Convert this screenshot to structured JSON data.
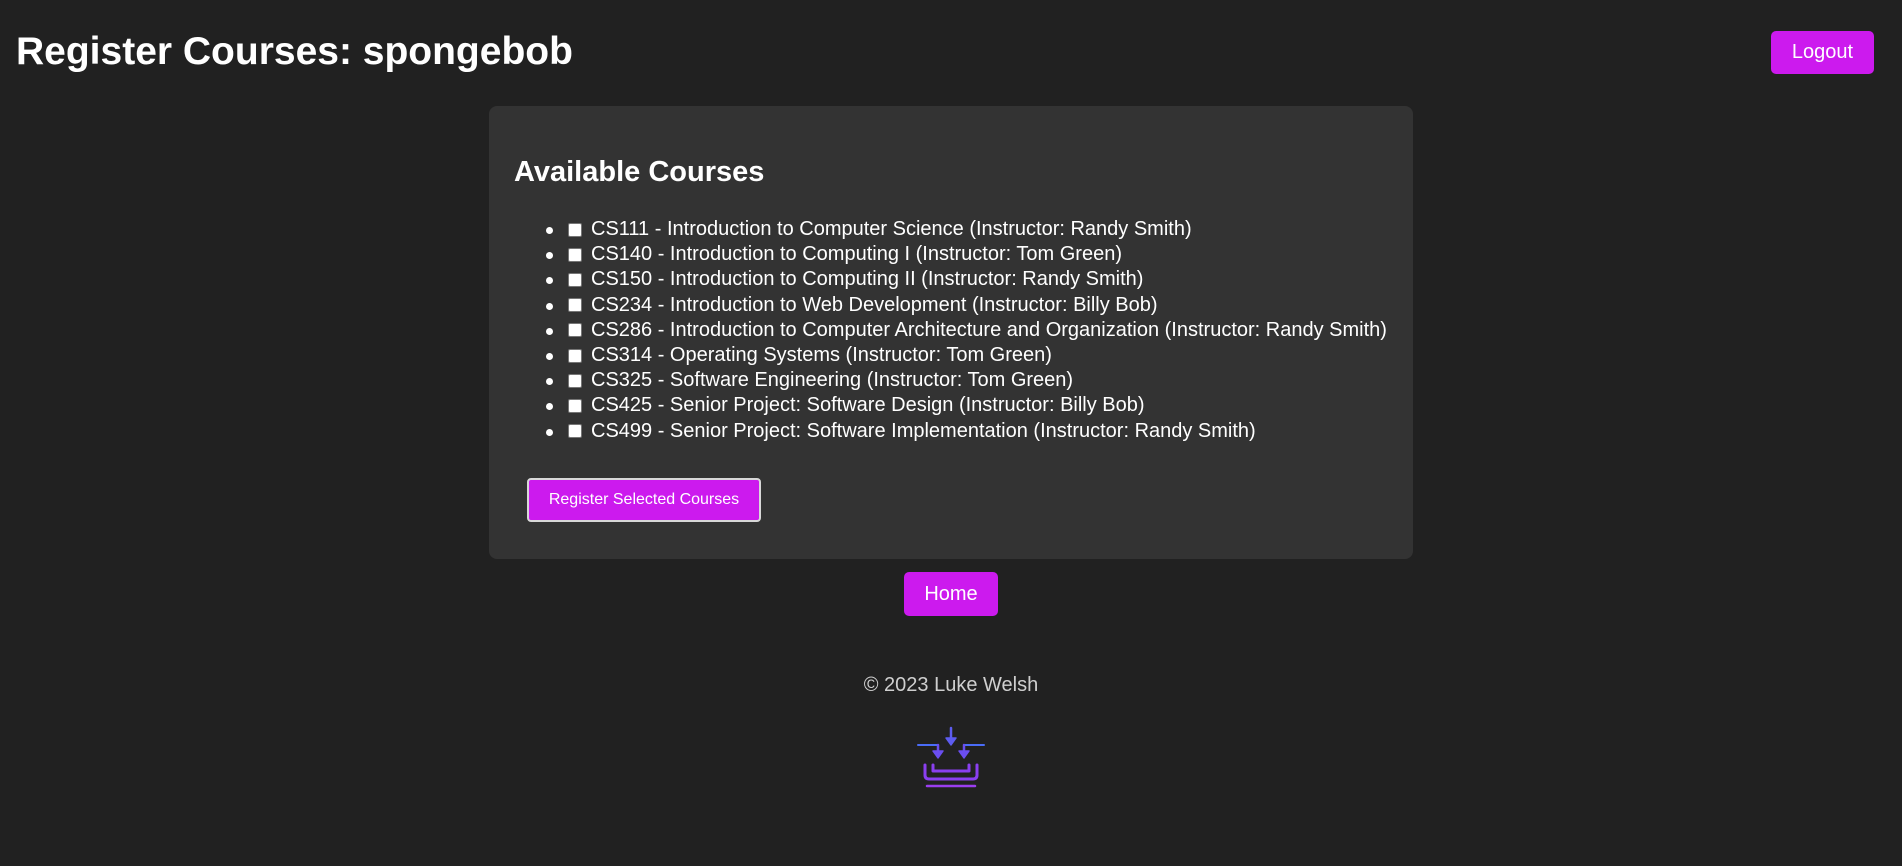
{
  "header": {
    "title": "Register Courses: spongebob",
    "logout_label": "Logout"
  },
  "panel": {
    "title": "Available Courses",
    "courses": [
      {
        "label": "CS111 - Introduction to Computer Science (Instructor: Randy Smith)",
        "checked": false
      },
      {
        "label": "CS140 - Introduction to Computing I (Instructor: Tom Green)",
        "checked": false
      },
      {
        "label": "CS150 - Introduction to Computing II (Instructor: Randy Smith)",
        "checked": false
      },
      {
        "label": "CS234 - Introduction to Web Development (Instructor: Billy Bob)",
        "checked": false
      },
      {
        "label": "CS286 - Introduction to Computer Architecture and Organization (Instructor: Randy Smith)",
        "checked": false
      },
      {
        "label": "CS314 - Operating Systems (Instructor: Tom Green)",
        "checked": false
      },
      {
        "label": "CS325 - Software Engineering (Instructor: Tom Green)",
        "checked": false
      },
      {
        "label": "CS425 - Senior Project: Software Design (Instructor: Billy Bob)",
        "checked": false
      },
      {
        "label": "CS499 - Senior Project: Software Implementation (Instructor: Randy Smith)",
        "checked": false
      }
    ],
    "register_label": "Register Selected Courses"
  },
  "nav": {
    "home_label": "Home"
  },
  "footer": {
    "copyright": "© 2023 Luke Welsh",
    "logo_icon": "download-tray-icon"
  },
  "colors": {
    "background": "#212121",
    "panel": "#333333",
    "accent": "#cc1aee"
  }
}
